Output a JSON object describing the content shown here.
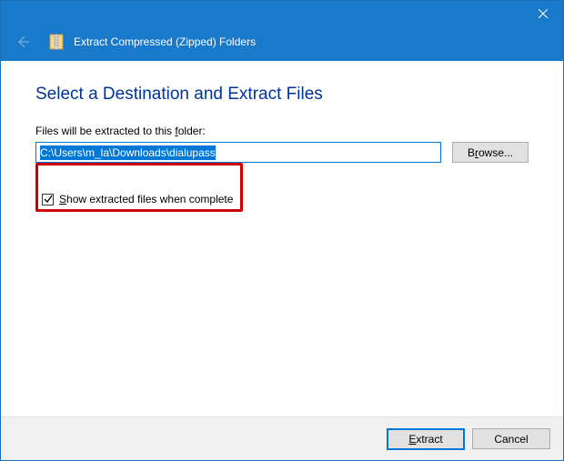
{
  "window": {
    "title": "Extract Compressed (Zipped) Folders"
  },
  "page": {
    "heading": "Select a Destination and Extract Files",
    "folder_label_pre": "Files will be extracted to this ",
    "folder_label_accel": "f",
    "folder_label_post": "older:",
    "path_value": "C:\\Users\\m_la\\Downloads\\dialupass"
  },
  "buttons": {
    "browse_accel": "r",
    "browse_pre": "B",
    "browse_post": "owse...",
    "extract_accel": "E",
    "extract_post": "xtract",
    "cancel": "Cancel"
  },
  "checkbox": {
    "checked": true,
    "label_accel": "S",
    "label_post": "how extracted files when complete"
  }
}
